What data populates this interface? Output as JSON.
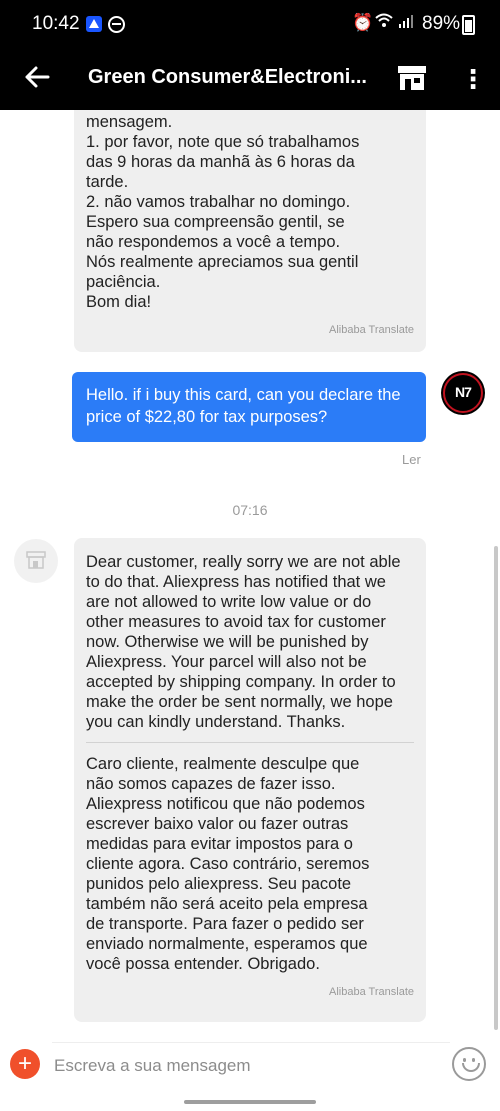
{
  "status_bar": {
    "time": "10:42",
    "battery": "89%",
    "icons": [
      "app-notification-icon",
      "do-not-disturb-icon",
      "alarm-icon",
      "wifi-icon",
      "signal-icon",
      "battery-icon"
    ]
  },
  "app_bar": {
    "title": "Green Consumer&Electroni...",
    "icons": [
      "back-arrow-icon",
      "store-icon",
      "more-vert-icon"
    ]
  },
  "messages": {
    "first_incoming": {
      "text": "mensagem.\n1. por favor, note que só trabalhamos\ndas 9 horas da manhã às 6 horas da\ntarde.\n2. não vamos trabalhar no domingo.\nEspero sua compreensão gentil, se\nnão respondemos a você a tempo.\nNós realmente apreciamos sua gentil\npaciência.\nBom dia!",
      "credit": "Alibaba Translate"
    },
    "outgoing": {
      "text": "Hello. if i buy this card, can you declare the price of $22,80 for tax purposes?",
      "status": "Ler",
      "avatar_label": "N7"
    },
    "timestamp": "07:16",
    "second_incoming": {
      "text_en": "Dear customer, really sorry we are not able\nto do that. Aliexpress has notified that we\nare not allowed to write low value or do\nother measures to avoid tax for customer\nnow. Otherwise we will be punished by\nAliexpress. Your parcel will also not be\naccepted by shipping company. In order to\nmake the order be sent normally, we hope\nyou can kindly understand. Thanks.",
      "text_pt": "Caro cliente, realmente desculpe que\nnão somos capazes de fazer isso.\nAliexpress notificou que não podemos\nescrever baixo valor ou fazer outras\nmedidas para evitar impostos para o\ncliente agora. Caso contrário, seremos\npunidos pelo aliexpress. Seu pacote\ntambém não será aceito pela empresa\nde transporte. Para fazer o pedido ser\nenviado normalmente, esperamos que\nvocê possa entender. Obrigado.",
      "credit": "Alibaba Translate"
    }
  },
  "input_bar": {
    "placeholder": "Escreva a sua mensagem",
    "add_label": "+",
    "accent": "#f0502b"
  },
  "colors": {
    "header": "#000000",
    "outgoing_bubble": "#2b7cf7",
    "incoming_bubble": "#efefef"
  }
}
